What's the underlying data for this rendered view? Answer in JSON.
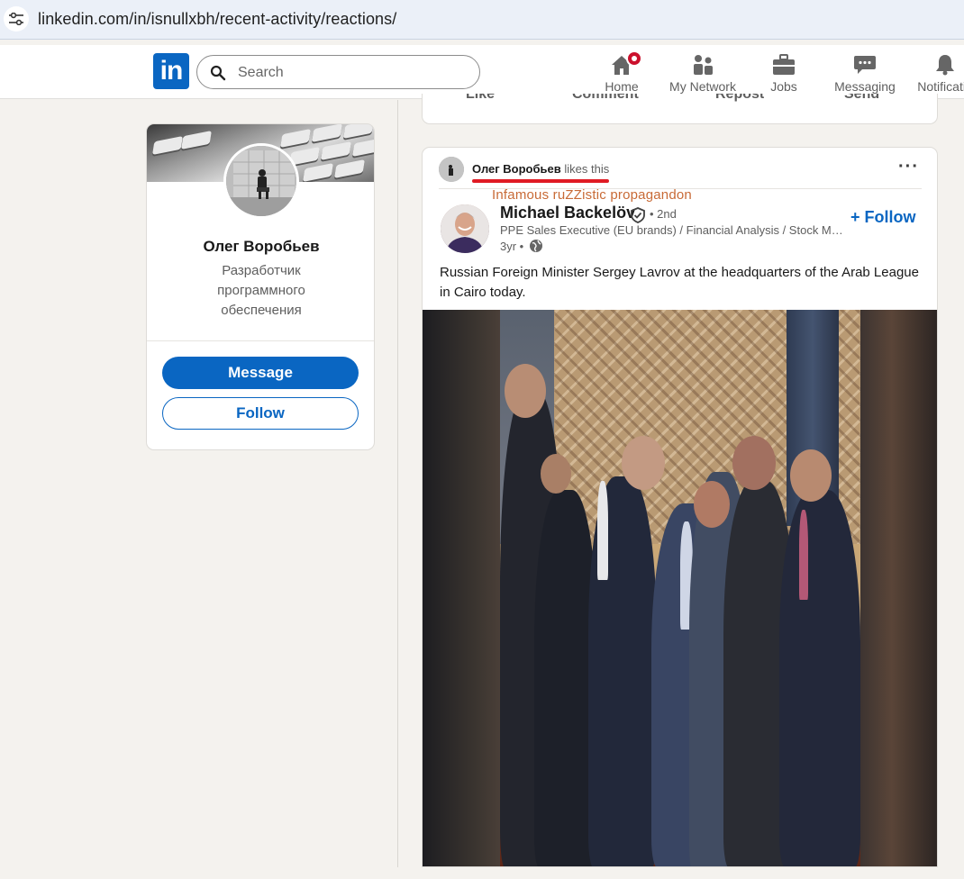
{
  "browser": {
    "url": "linkedin.com/in/isnullxbh/recent-activity/reactions/",
    "site_info_icon": "tune-icon"
  },
  "nav": {
    "logo_text": "in",
    "search_placeholder": "Search",
    "items": [
      {
        "label": "Home",
        "icon": "home-icon"
      },
      {
        "label": "My Network",
        "icon": "network-icon"
      },
      {
        "label": "Jobs",
        "icon": "briefcase-icon"
      },
      {
        "label": "Messaging",
        "icon": "messaging-icon"
      },
      {
        "label": "Notificatio",
        "icon": "bell-icon"
      }
    ]
  },
  "profile_card": {
    "name": "Олег Воробьев",
    "headline": "Разработчик программного обеспечения",
    "message_label": "Message",
    "follow_label": "Follow"
  },
  "prev_post_actions": [
    "Like",
    "Comment",
    "Repost",
    "Send"
  ],
  "post": {
    "reactor_name": "Олег Воробьев",
    "reactor_action": "likes this",
    "annotation": "Infamous ruZZistic propagandon",
    "author_name": "Michael Backelöv",
    "degree": "• 2nd",
    "author_headline": "PPE Sales Executive (EU brands) / Financial Analysis / Stock Market Analysis",
    "time": "3yr •",
    "follow_label": "Follow",
    "text": "Russian Foreign Minister Sergey Lavrov at the headquarters of the Arab League in Cairo today."
  },
  "colors": {
    "brand_blue": "#0a66c2",
    "annotation_red": "#e01b24",
    "annotation_text": "#c86a36",
    "notification_badge": "#cb112d"
  }
}
